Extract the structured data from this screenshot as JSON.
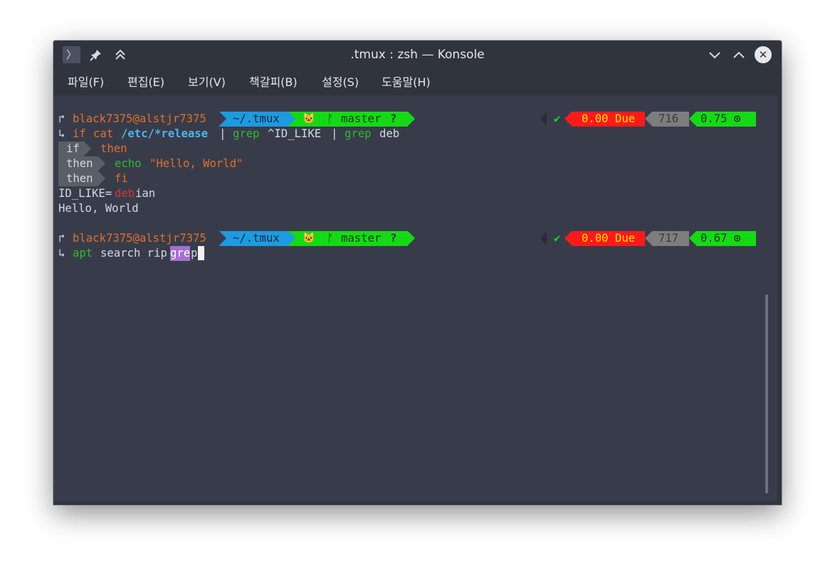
{
  "window": {
    "title": ".tmux : zsh — Konsole",
    "app_icon_glyph": "〉",
    "pin_glyph": "✦",
    "keep_above_glyph": "⌃",
    "minimize_glyph": "∨",
    "maximize_glyph": "∧",
    "close_glyph": "✕"
  },
  "menu": [
    "파일(F)",
    "편집(E)",
    "보기(V)",
    "책갈피(B)",
    "설정(S)",
    "도움말(H)"
  ],
  "prompt1": {
    "arrow": "↱",
    "user_host": "black7375@alstjr7375",
    "dir": "~/.tmux",
    "git_icon": "🐱",
    "branch_icon": "ᚠ",
    "branch": "master",
    "branch_status": "?",
    "check": "✔",
    "due": "0.00 Due",
    "count": "716",
    "load": "0.75",
    "circle": "⊙"
  },
  "command1": {
    "arrow": "↳",
    "if": "if",
    "cat": "cat",
    "path": "/etc/*release",
    "pipe1": "|",
    "grep1": "grep",
    "pattern": "^ID_LIKE",
    "pipe2": "|",
    "grep2": "grep",
    "arg": "deb"
  },
  "continuation": [
    {
      "badge": "if",
      "text": "then"
    },
    {
      "badge": "then",
      "cmd": "echo",
      "text": "\"Hello, World\""
    },
    {
      "badge": "then",
      "text": "fi"
    }
  ],
  "output": {
    "id_like_prefix": "ID_LIKE=",
    "id_like_match": "deb",
    "id_like_suffix": "ian",
    "hello": "Hello, World"
  },
  "prompt2": {
    "arrow": "↱",
    "user_host": "black7375@alstjr7375",
    "dir": "~/.tmux",
    "git_icon": "🐱",
    "branch_icon": "ᚠ",
    "branch": "master",
    "branch_status": "?",
    "check": "✔",
    "due": "0.00 Due",
    "count": "717",
    "load": "0.67",
    "circle": "⊙"
  },
  "command2": {
    "arrow": "↳",
    "cmd": "apt",
    "args": "search rip",
    "highlight": "gre",
    "rest": "p"
  },
  "colors": {
    "terminal_bg": "#383c4a",
    "titlebar_bg": "#2f343f",
    "dir_segment": "#1e9ae0",
    "git_segment": "#16d916",
    "due_segment": "#ff1a1a",
    "count_segment": "#7d7d7d",
    "load_segment": "#16d916",
    "orange": "#e0702a",
    "green": "#2fb82f",
    "blue": "#4fb2e8"
  }
}
